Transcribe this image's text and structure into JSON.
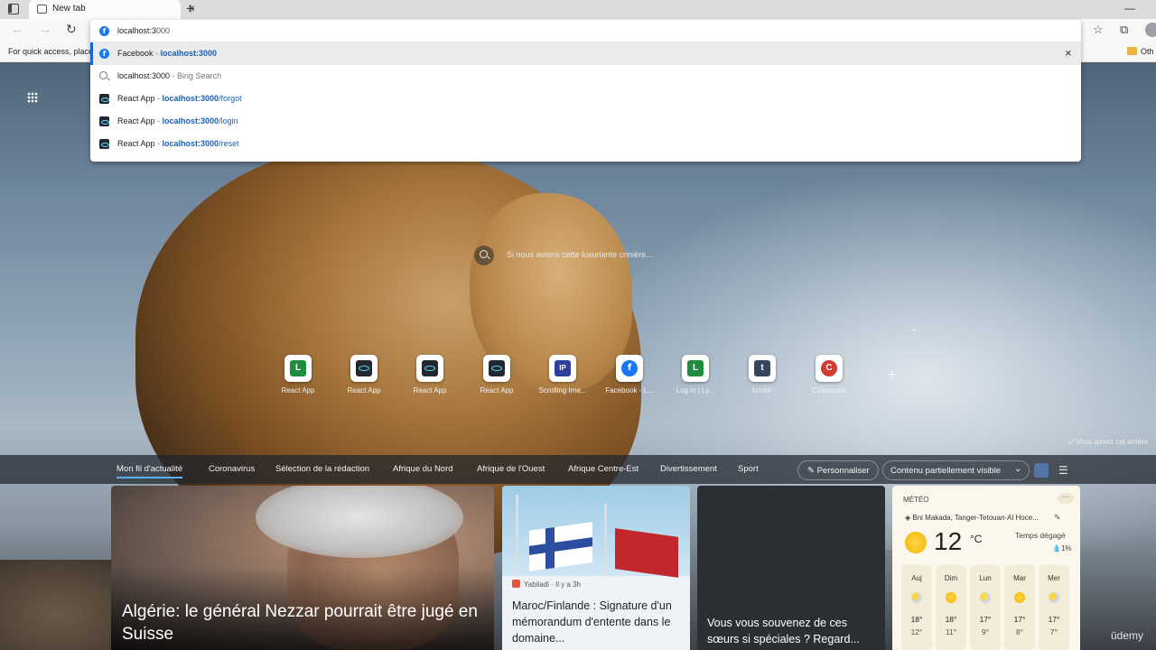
{
  "browser": {
    "tab_title": "New tab",
    "tab_close": "×",
    "new_tab": "+",
    "minimize": "—",
    "favorites_text": "For quick access, place y",
    "other_favorites": "Oth"
  },
  "omnibox": {
    "typed": "localhost:3",
    "autocompleted": "000",
    "suggestions": [
      {
        "title": "Facebook",
        "sep": " - ",
        "url": "localhost:3000",
        "path": "",
        "icon": "facebook-icon",
        "selected": true
      },
      {
        "title": "localhost:3000",
        "sep": " - ",
        "url": "",
        "path": "Bing Search",
        "icon": "search-icon",
        "selected": false
      },
      {
        "title": "React App",
        "sep": " - ",
        "url": "localhost:3000",
        "path": "/forgot",
        "icon": "react-icon",
        "selected": false
      },
      {
        "title": "React App",
        "sep": " - ",
        "url": "localhost:3000",
        "path": "/login",
        "icon": "react-icon",
        "selected": false
      },
      {
        "title": "React App",
        "sep": " - ",
        "url": "localhost:3000",
        "path": "/reset",
        "icon": "react-icon",
        "selected": false
      }
    ],
    "remove_label": "×"
  },
  "newtab": {
    "search_caption": "Si nous avions cette luxuriante crinière...",
    "image_credit": "Vous aimez cet arrière",
    "add_quicklink": "+",
    "quick_links": [
      {
        "label": "React App",
        "glyph": "L",
        "icon": "l-icon"
      },
      {
        "label": "React App",
        "glyph": "",
        "icon": "react-icon"
      },
      {
        "label": "React App",
        "glyph": "",
        "icon": "react-icon"
      },
      {
        "label": "React App",
        "glyph": "",
        "icon": "react-icon"
      },
      {
        "label": "Scrolling Ima...",
        "glyph": "IP",
        "icon": "ip-icon"
      },
      {
        "label": "Facebook - L...",
        "glyph": "f",
        "icon": "facebook-icon"
      },
      {
        "label": "Log in | Ly...",
        "glyph": "L",
        "icon": "l-icon"
      },
      {
        "label": "tumblr",
        "glyph": "t",
        "icon": "tumblr-icon"
      },
      {
        "label": "CDiscount",
        "glyph": "C",
        "icon": "cdiscount-icon"
      }
    ]
  },
  "news": {
    "tabs": [
      "Mon fil d'actualité",
      "Coronavirus",
      "Sélection de la rédaction",
      "Afrique du Nord",
      "Afrique de l'Ouest",
      "Afrique Centre-Est",
      "Divertissement",
      "Sport"
    ],
    "active_tab": 0,
    "personalize": "✎ Personnaliser",
    "content_visibility": "Contenu partiellement visible",
    "cards": {
      "main_title": "Algérie: le général Nezzar pourrait être jugé en Suisse",
      "second_source": "Yabiladi · Il y a 3h",
      "second_title": "Maroc/Finlande : Signature d'un mémorandum d'entente dans le domaine...",
      "third_title": "Vous vous souvenez de ces sœurs si spéciales ? Regard..."
    },
    "weather": {
      "header": "MÉTÉO",
      "more": "···",
      "location": "◈ Bni Makada, Tanger-Tetouan-Al Hoce...",
      "edit": "✎",
      "temp": "12",
      "unit": "°C",
      "condition": "Temps dégagé",
      "precip": "💧1%",
      "days": [
        {
          "name": "Auj",
          "hi": "18°",
          "lo": "12°"
        },
        {
          "name": "Dim",
          "hi": "18°",
          "lo": "11°"
        },
        {
          "name": "Lun",
          "hi": "17°",
          "lo": "9°"
        },
        {
          "name": "Mar",
          "hi": "17°",
          "lo": "8°"
        },
        {
          "name": "Mer",
          "hi": "17°",
          "lo": "7°"
        }
      ]
    }
  },
  "watermark": "ūdemy"
}
